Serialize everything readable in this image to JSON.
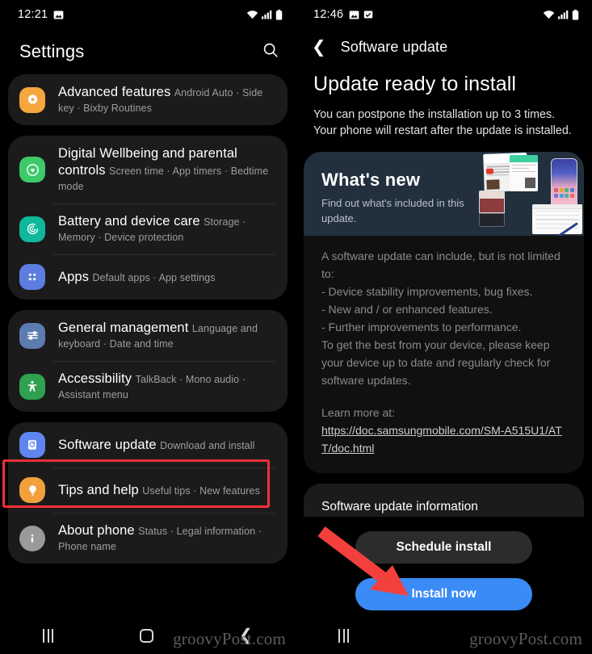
{
  "left_phone": {
    "status_bar": {
      "time": "12:21",
      "left_icons": [
        "image-icon"
      ],
      "right_icons": [
        "wifi-icon",
        "signal-icon",
        "battery-icon"
      ]
    },
    "header": {
      "title": "Settings",
      "search_icon": "search-icon"
    },
    "groups": [
      {
        "rows": [
          {
            "title": "Advanced features",
            "subtitle": "Android Auto  ·  Side key  ·  Bixby Routines",
            "icon": "gear-icon",
            "icon_color": "#f5a councils"
          }
        ]
      }
    ],
    "sections": [
      {
        "id": "group-1",
        "items": [
          {
            "title": "Advanced features",
            "subtitle": "Android Auto  ·  Side key  ·  Bixby Routines",
            "icon": "gear-icon",
            "icon_bg": "#f5a63f",
            "icon_shape": "squircle"
          }
        ]
      },
      {
        "id": "group-2",
        "items": [
          {
            "title": "Digital Wellbeing and parental controls",
            "subtitle": "Screen time  ·  App timers  ·  Bedtime mode",
            "icon": "wellbeing-icon",
            "icon_bg": "#3ec96b",
            "icon_shape": "squircle"
          },
          {
            "title": "Battery and device care",
            "subtitle": "Storage  ·  Memory  ·  Device protection",
            "icon": "device-care-icon",
            "icon_bg": "#0fb89b",
            "icon_shape": "squircle"
          },
          {
            "title": "Apps",
            "subtitle": "Default apps  ·  App settings",
            "icon": "apps-grid-icon",
            "icon_bg": "#5d7ee0",
            "icon_shape": "squircle"
          }
        ]
      },
      {
        "id": "group-3",
        "items": [
          {
            "title": "General management",
            "subtitle": "Language and keyboard  ·  Date and time",
            "icon": "sliders-icon",
            "icon_bg": "#5c7bb0",
            "icon_shape": "squircle"
          },
          {
            "title": "Accessibility",
            "subtitle": "TalkBack  ·  Mono audio  ·  Assistant menu",
            "icon": "accessibility-person-icon",
            "icon_bg": "#2fa14f",
            "icon_shape": "squircle"
          }
        ]
      },
      {
        "id": "group-4",
        "items": [
          {
            "title": "Software update",
            "subtitle": "Download and install",
            "icon": "software-update-icon",
            "icon_bg": "#5f85ef",
            "icon_shape": "squircle"
          },
          {
            "title": "Tips and help",
            "subtitle": "Useful tips  ·  New features",
            "icon": "lightbulb-icon",
            "icon_bg": "#f2a03c",
            "icon_shape": "squircle"
          },
          {
            "title": "About phone",
            "subtitle": "Status  ·  Legal information  ·  Phone name",
            "icon": "info-icon",
            "icon_bg": "#9a9a9a",
            "icon_shape": "circle"
          }
        ]
      }
    ],
    "highlight": {
      "color": "#f4303b",
      "target": "Software update"
    },
    "nav_bar": {
      "recents": "recents-icon",
      "home": "home-icon",
      "back": "back-icon"
    },
    "watermark": "groovyPost.com"
  },
  "right_phone": {
    "status_bar": {
      "time": "12:46",
      "left_icons": [
        "image-icon",
        "check-icon"
      ],
      "right_icons": [
        "wifi-icon",
        "signal-icon",
        "battery-icon"
      ]
    },
    "header": {
      "back_icon": "chevron-left-icon",
      "title": "Software update"
    },
    "heading": "Update ready to install",
    "description": "You can postpone the installation up to 3 times. Your phone will restart after the update is installed.",
    "whats_new": {
      "title": "What's new",
      "subtitle": "Find out what's included in this update.",
      "banner_color": "#22303e"
    },
    "details": {
      "intro": "A software update can include, but is not limited to:",
      "bullets": [
        "- Device stability improvements, bug fixes.",
        "- New and / or enhanced features.",
        "- Further improvements to performance."
      ],
      "outro": "To get the best from your device, please keep your device up to date and regularly check for software updates.",
      "learn_more_label": "Learn more at:",
      "learn_more_url": "https://doc.samsungmobile.com/SM-A515U1/ATT/doc.html"
    },
    "info_card_title": "Software update information",
    "buttons": {
      "schedule": "Schedule install",
      "install": "Install now",
      "install_color": "#3a8bf5"
    },
    "arrow": {
      "color": "#f4403c",
      "points_to": "Install now"
    },
    "nav_bar": {
      "recents": "recents-icon"
    },
    "watermark": "groovyPost.com"
  }
}
